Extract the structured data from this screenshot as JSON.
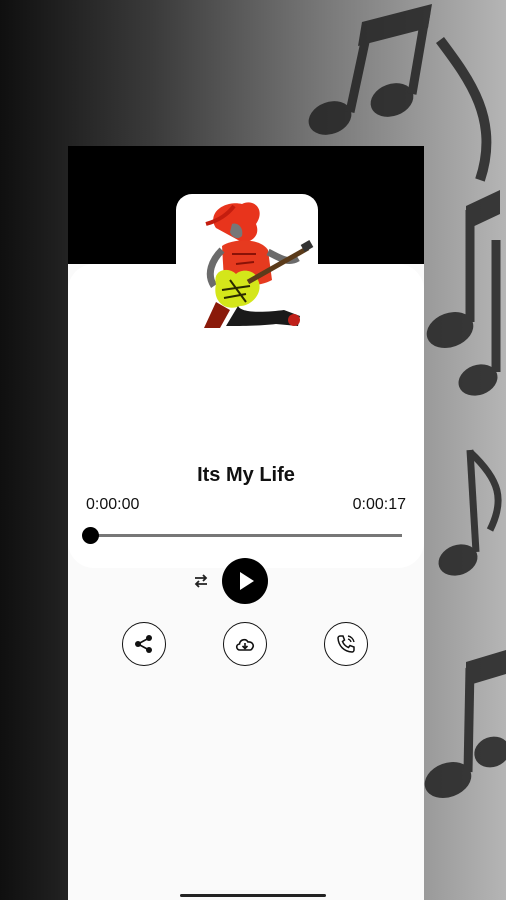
{
  "song": {
    "title": "Its My Life",
    "current_time": "0:00:00",
    "total_time": "0:00:17",
    "progress": 0
  },
  "icons": {
    "background": "music-notes",
    "artwork": "guitarist-artwork",
    "repeat": "repeat-icon",
    "play": "play-icon",
    "share": "share-icon",
    "download": "cloud-download-icon",
    "ringtone": "phone-ringtone-icon"
  },
  "colors": {
    "accent": "#000000",
    "card": "#ffffff",
    "artwork_hair": "#e8341c",
    "artwork_guitar": "#d4e61a"
  }
}
